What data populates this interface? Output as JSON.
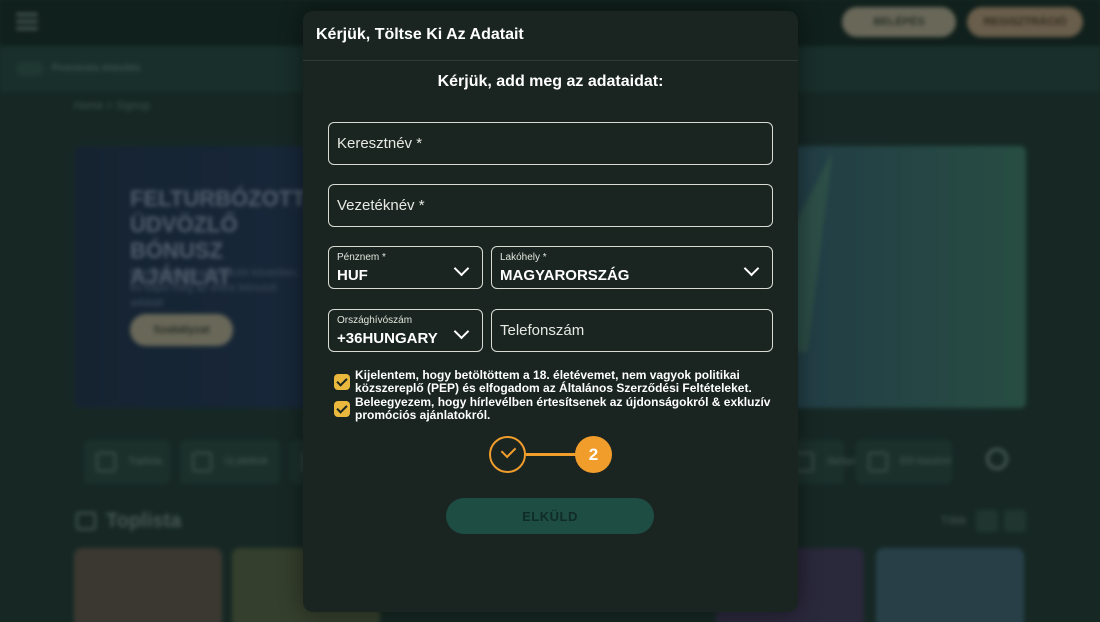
{
  "background": {
    "header": {
      "logo": "",
      "login_label": "BELÉPÉS",
      "register_label": "REGISZTRÁCIÓ"
    },
    "promo_label": "Promóciós értesítés",
    "breadcrumb": "Home > Signup",
    "banner": {
      "title": "FELTURBÓZOTT ÜDVÖZLŐ BÓNUSZ AJÁNLAT",
      "text": "Fizess be a regisztrációt követően, és kapd meg az extra bónuszt adatait",
      "button_label": "Szabályzat"
    },
    "categories": [
      {
        "label": "Toplista"
      },
      {
        "label": "Új játékok"
      },
      {
        "label": "Jackpot"
      },
      {
        "label": "Élő kaszinó"
      }
    ],
    "section_title": "Toplista",
    "all_link": "Több"
  },
  "modal": {
    "title": "Kérjük, Töltse Ki Az Adatait",
    "subtitle": "Kérjük, add meg az adataidat:",
    "first_name_placeholder": "Keresztnév *",
    "last_name_placeholder": "Vezetéknév *",
    "currency": {
      "label": "Pénznem *",
      "value": "HUF"
    },
    "residence": {
      "label": "Lakóhely *",
      "value": "MAGYARORSZÁG"
    },
    "country_code": {
      "label": "Országhívószám",
      "value": "+36HUNGARY"
    },
    "phone_placeholder": "Telefonszám",
    "consent_terms": "Kijelentem, hogy betöltöttem a 18. életévemet, nem vagyok politikai közszereplő (PEP) és elfogadom az Általános Szerződési Feltételeket.",
    "consent_newsletter": "Beleegyezem, hogy hírlevélben értesítsenek az újdonságokról & exkluzív promóciós ajánlatokról.",
    "step_current": "2",
    "submit_label": "ELKÜLD"
  },
  "colors": {
    "accent": "#f19d2c",
    "checkbox": "#e9b83c",
    "modal_bg": "#1a2522",
    "submit_bg": "#1e4d44"
  }
}
